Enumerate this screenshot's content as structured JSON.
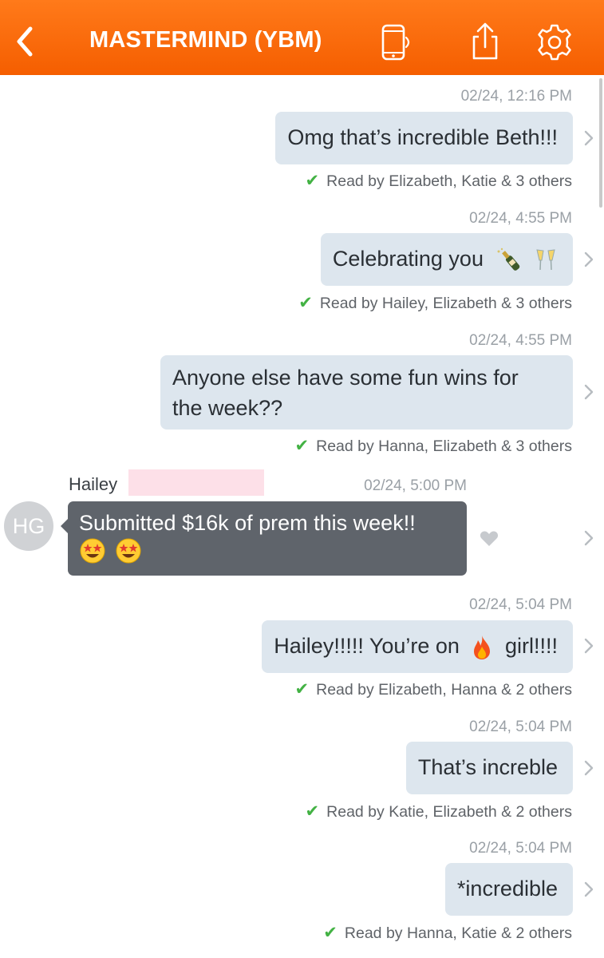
{
  "header": {
    "title": "MASTERMIND (YBM)",
    "icons": [
      "back-chevron-icon",
      "phone-icon",
      "share-icon",
      "gear-icon"
    ],
    "background": "#f76300"
  },
  "messages": [
    {
      "timestamp": "02/24, 12:16 PM",
      "text": "Omg that’s incredible Beth!!!",
      "read": "Read by Elizabeth, Katie & 3 others"
    },
    {
      "timestamp": "02/24, 4:55 PM",
      "text": "Celebrating you",
      "emoji": [
        "champagne-bottle-icon",
        "clinking-glasses-icon"
      ],
      "read": "Read by Hailey, Elizabeth & 3 others"
    },
    {
      "timestamp": "02/24, 4:55 PM",
      "line1": "Anyone else have some fun wins for",
      "line2": "the week??",
      "read": "Read by Hanna, Elizabeth & 3 others"
    },
    {
      "sender": "Hailey",
      "avatar": "HG",
      "timestamp": "02/24, 5:00 PM",
      "text": "Submitted $16k of prem this week!!",
      "emoji": [
        "star-struck-face-icon",
        "star-struck-face-icon"
      ]
    },
    {
      "timestamp": "02/24, 5:04 PM",
      "text_before": "Hailey!!!!! You’re on",
      "text_after": "girl!!!!",
      "emoji": [
        "fire-icon"
      ],
      "read": "Read by Elizabeth, Hanna & 2 others"
    },
    {
      "timestamp": "02/24, 5:04 PM",
      "text": "That’s increble",
      "read": "Read by Katie, Elizabeth & 2 others"
    },
    {
      "timestamp": "02/24, 5:04 PM",
      "text": "*incredible",
      "read": "Read by Hanna, Katie & 2 others"
    }
  ],
  "colors": {
    "outgoing_bubble": "#dde6ee",
    "incoming_bubble": "#5f646b",
    "read_check": "#43b244"
  }
}
